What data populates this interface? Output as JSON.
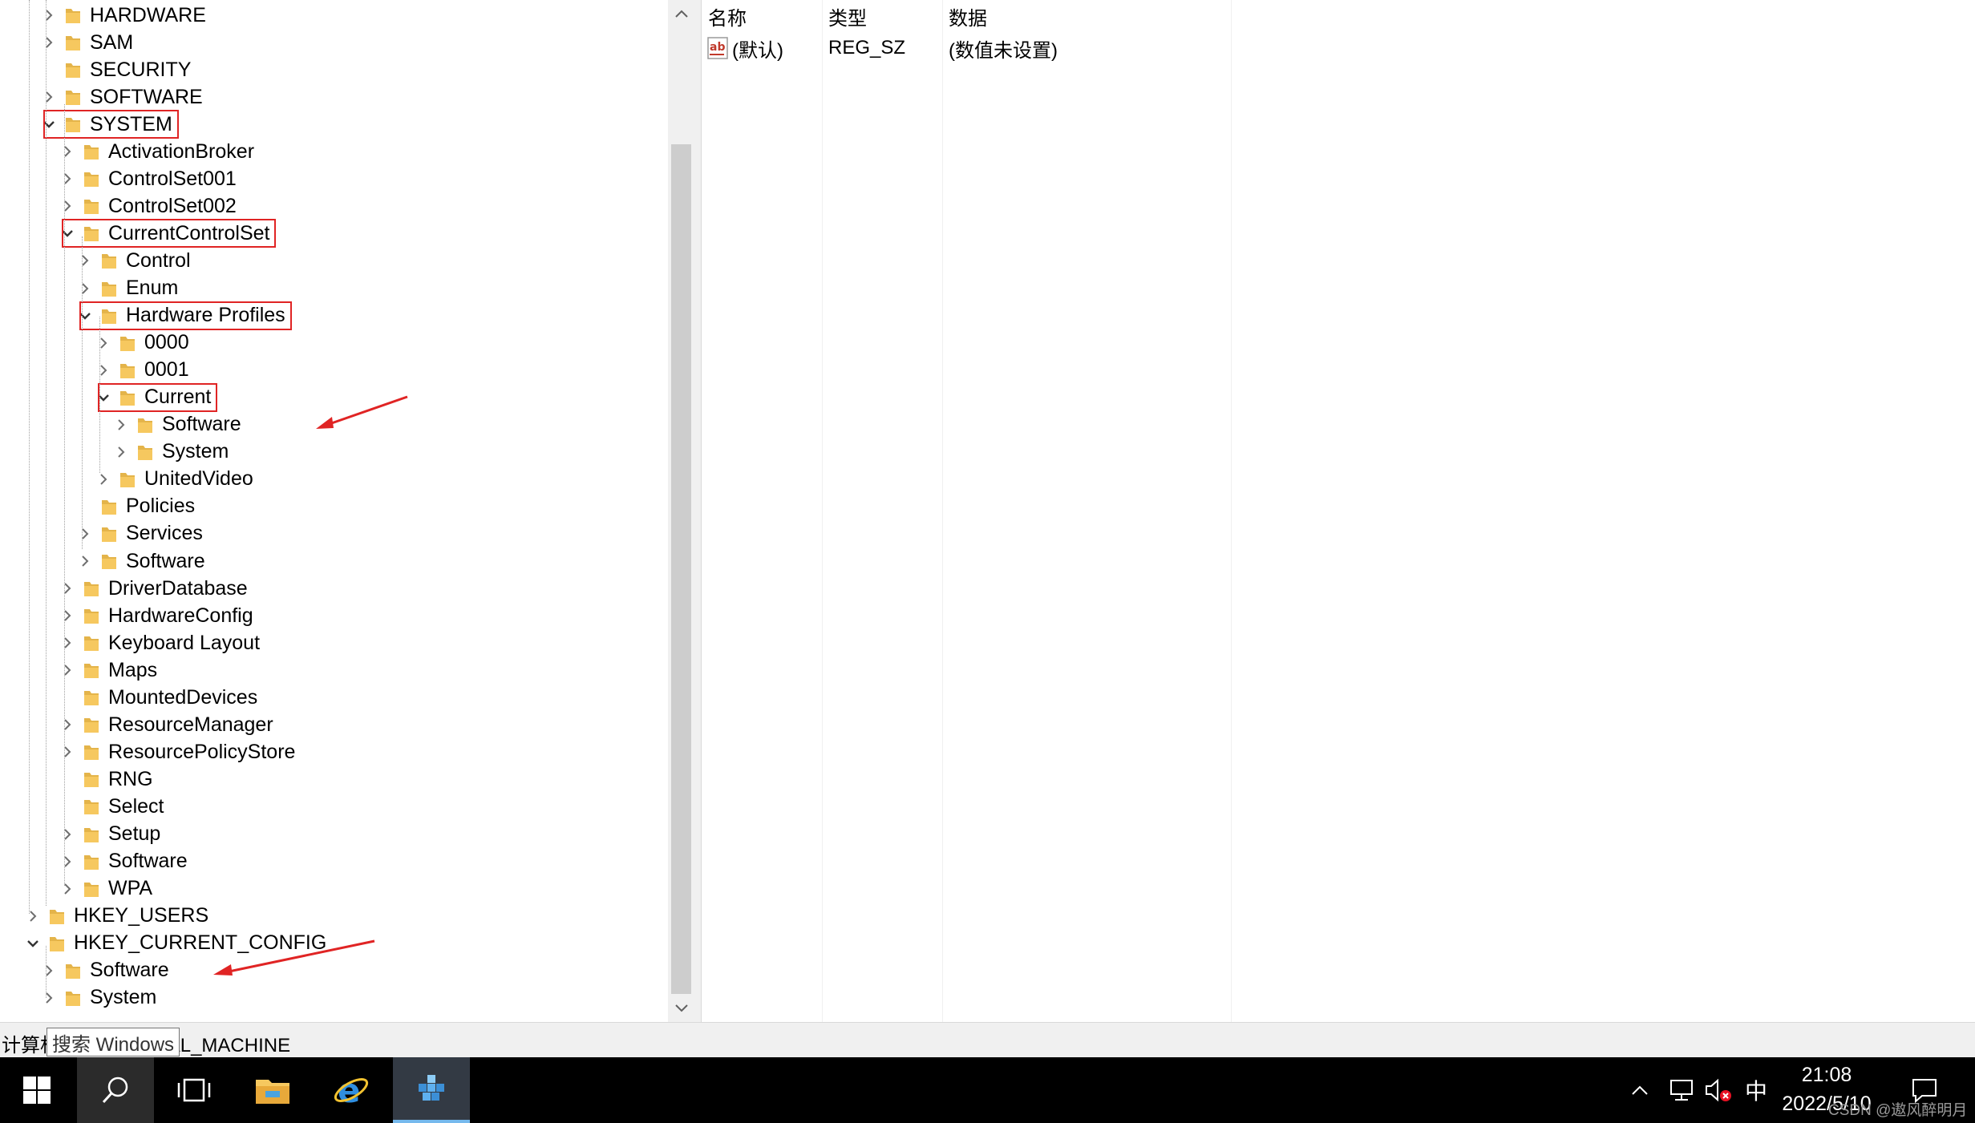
{
  "tree": {
    "nodes": [
      {
        "label": "HARDWARE",
        "level": 2,
        "expand": "collapsed"
      },
      {
        "label": "SAM",
        "level": 2,
        "expand": "collapsed"
      },
      {
        "label": "SECURITY",
        "level": 2,
        "expand": "none"
      },
      {
        "label": "SOFTWARE",
        "level": 2,
        "expand": "collapsed"
      },
      {
        "label": "SYSTEM",
        "level": 2,
        "expand": "expanded",
        "highlighted": true
      },
      {
        "label": "ActivationBroker",
        "level": 3,
        "expand": "collapsed"
      },
      {
        "label": "ControlSet001",
        "level": 3,
        "expand": "collapsed"
      },
      {
        "label": "ControlSet002",
        "level": 3,
        "expand": "collapsed"
      },
      {
        "label": "CurrentControlSet",
        "level": 3,
        "expand": "expanded",
        "highlighted": true
      },
      {
        "label": "Control",
        "level": 4,
        "expand": "collapsed"
      },
      {
        "label": "Enum",
        "level": 4,
        "expand": "collapsed"
      },
      {
        "label": "Hardware Profiles",
        "level": 4,
        "expand": "expanded",
        "highlighted": true
      },
      {
        "label": "0000",
        "level": 5,
        "expand": "collapsed"
      },
      {
        "label": "0001",
        "level": 5,
        "expand": "collapsed"
      },
      {
        "label": "Current",
        "level": 5,
        "expand": "expanded",
        "highlighted": true
      },
      {
        "label": "Software",
        "level": 6,
        "expand": "collapsed",
        "arrow": true
      },
      {
        "label": "System",
        "level": 6,
        "expand": "collapsed"
      },
      {
        "label": "UnitedVideo",
        "level": 5,
        "expand": "collapsed"
      },
      {
        "label": "Policies",
        "level": 4,
        "expand": "none"
      },
      {
        "label": "Services",
        "level": 4,
        "expand": "collapsed"
      },
      {
        "label": "Software",
        "level": 4,
        "expand": "collapsed"
      },
      {
        "label": "DriverDatabase",
        "level": 3,
        "expand": "collapsed"
      },
      {
        "label": "HardwareConfig",
        "level": 3,
        "expand": "collapsed"
      },
      {
        "label": "Keyboard Layout",
        "level": 3,
        "expand": "collapsed"
      },
      {
        "label": "Maps",
        "level": 3,
        "expand": "collapsed"
      },
      {
        "label": "MountedDevices",
        "level": 3,
        "expand": "none"
      },
      {
        "label": "ResourceManager",
        "level": 3,
        "expand": "collapsed"
      },
      {
        "label": "ResourcePolicyStore",
        "level": 3,
        "expand": "collapsed"
      },
      {
        "label": "RNG",
        "level": 3,
        "expand": "none"
      },
      {
        "label": "Select",
        "level": 3,
        "expand": "none"
      },
      {
        "label": "Setup",
        "level": 3,
        "expand": "collapsed"
      },
      {
        "label": "Software",
        "level": 3,
        "expand": "collapsed"
      },
      {
        "label": "WPA",
        "level": 3,
        "expand": "collapsed"
      },
      {
        "label": "HKEY_USERS",
        "level": 1,
        "expand": "collapsed"
      },
      {
        "label": "HKEY_CURRENT_CONFIG",
        "level": 1,
        "expand": "expanded"
      },
      {
        "label": "Software",
        "level": 2,
        "expand": "collapsed",
        "arrow": true
      },
      {
        "label": "System",
        "level": 2,
        "expand": "collapsed"
      }
    ]
  },
  "values": {
    "columns": [
      "名称",
      "类型",
      "数据"
    ],
    "rows": [
      {
        "name": "(默认)",
        "type": "REG_SZ",
        "data": "(数值未设置)",
        "icon": "string-value-icon"
      }
    ]
  },
  "status": {
    "path": "计算机\\HKEY_LOCAL_MACHINE",
    "tooltip": "搜索 Windows"
  },
  "taskbar": {
    "tray_ime": "中",
    "time": "21:08",
    "date": "2022/5/10"
  },
  "watermark": "CSDN @遨风醉明月",
  "colors": {
    "highlight": "#e02424",
    "folder": "#f6c85f",
    "taskbar": "#000000"
  }
}
